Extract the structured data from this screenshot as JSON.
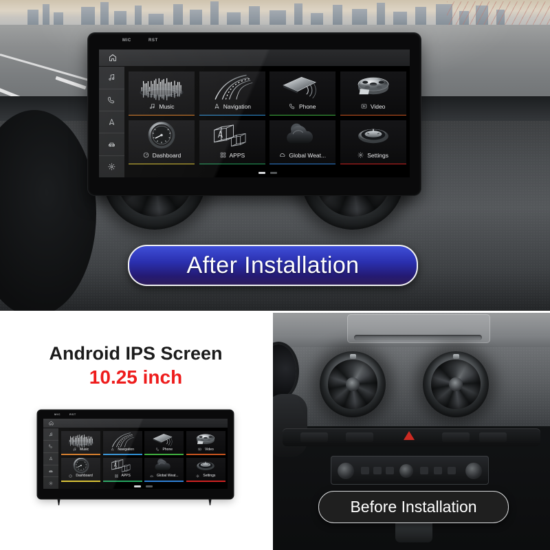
{
  "product": {
    "headline": "Android IPS Screen",
    "size": "10.25 inch"
  },
  "badges": {
    "after": "After Installation",
    "before": "Before Installation"
  },
  "head_unit": {
    "bezel_labels": [
      "MIC",
      "RST"
    ],
    "top_bar": {
      "home_icon": "home-icon"
    },
    "sidebar": [
      {
        "icon": "music-note-icon",
        "name": "music"
      },
      {
        "icon": "phone-handset-icon",
        "name": "phone"
      },
      {
        "icon": "navigation-arrow-icon",
        "name": "navigation"
      },
      {
        "icon": "car-icon",
        "name": "car"
      },
      {
        "icon": "gear-icon",
        "name": "settings"
      }
    ],
    "tiles": [
      {
        "label": "Music",
        "icon": "music-note-icon",
        "art": "equalizer-art",
        "accent": "#d4761f"
      },
      {
        "label": "Navigation",
        "icon": "navigation-arrow-icon",
        "art": "road-art",
        "accent": "#2f8fd4"
      },
      {
        "label": "Phone",
        "icon": "phone-handset-icon",
        "art": "smartphone-art",
        "accent": "#3fae3f"
      },
      {
        "label": "Video",
        "icon": "video-frame-icon",
        "art": "film-reel-art",
        "accent": "#c8541f"
      },
      {
        "label": "Dashboard",
        "icon": "gauge-icon",
        "art": "speedometer-art",
        "accent": "#d8c02a"
      },
      {
        "label": "APPS",
        "icon": "grid-apps-icon",
        "art": "cubes-art",
        "accent": "#25a35f"
      },
      {
        "label": "Global Weat...",
        "icon": "cloud-icon",
        "art": "cloud-art",
        "accent": "#2f7fd4"
      },
      {
        "label": "Settings",
        "icon": "gear-icon",
        "art": "dial-art",
        "accent": "#cf2222"
      }
    ],
    "pager": {
      "pages": 2,
      "active": 1
    }
  },
  "colors": {
    "accent_badge_after_top": "#3f4fd8",
    "accent_badge_after_bottom": "#2d1d5c",
    "size_text": "#ee1c1c",
    "headline_text": "#1b1b1b",
    "badge_before_bg": "#1f1f1f"
  }
}
